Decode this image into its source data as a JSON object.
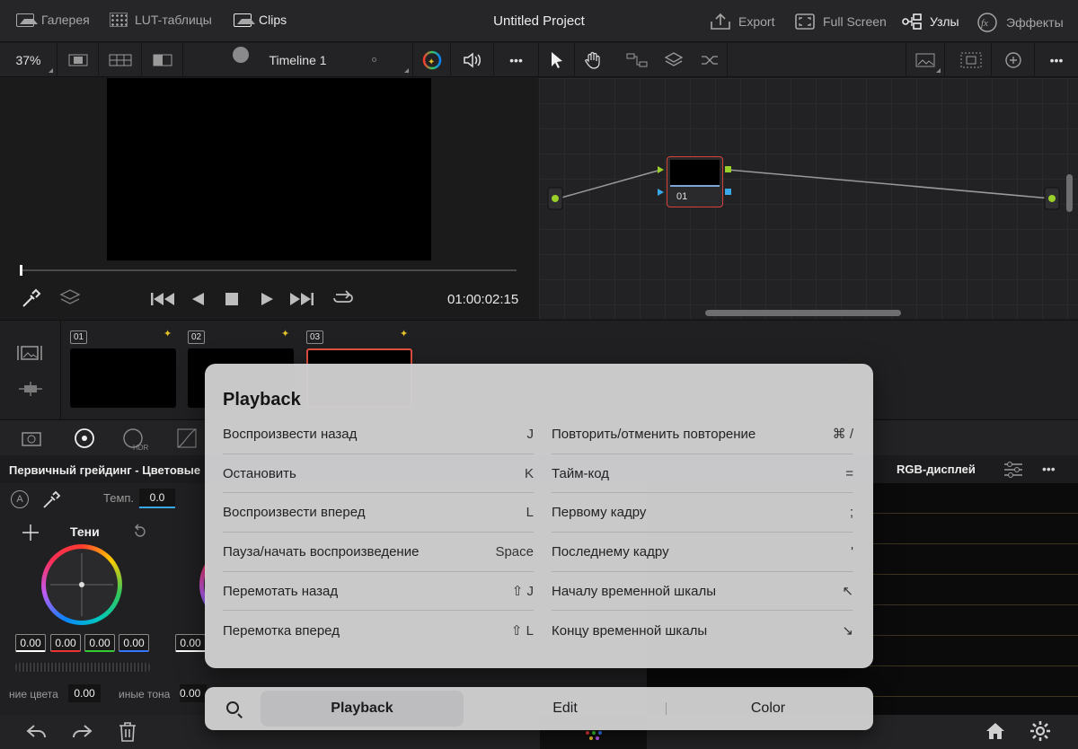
{
  "topbar": {
    "gallery": "Галерея",
    "luts": "LUT-таблицы",
    "clips": "Clips",
    "project_title": "Untitled Project",
    "export": "Export",
    "fullscreen": "Full Screen",
    "nodes": "Узлы",
    "effects": "Эффекты"
  },
  "toolbar2": {
    "zoom": "37%",
    "timeline": "Timeline 1",
    "more": "•••"
  },
  "viewer": {
    "timecode": "01:00:02:15"
  },
  "node_graph": {
    "node_label": "01"
  },
  "clips": [
    {
      "num": "01"
    },
    {
      "num": "02"
    },
    {
      "num": "03"
    }
  ],
  "panels": {
    "primary_title": "Первичный грейдинг - Цветовые",
    "temp_label": "Темп.",
    "temp_value": "0.0",
    "shadows_label": "Тени",
    "shadow_values": [
      "0.00",
      "0.00",
      "0.00",
      "0.00"
    ],
    "wheel2_value": "0.00",
    "rgb_title": "RGB-дисплей",
    "color_boost_label": "ние цвета",
    "color_boost_value": "0.00",
    "tone_label": "иные тона",
    "tone_value": "0.00"
  },
  "shortcuts": {
    "title": "Playback",
    "left": [
      {
        "label": "Воспроизвести назад",
        "key": "J"
      },
      {
        "label": "Остановить",
        "key": "K"
      },
      {
        "label": "Воспроизвести вперед",
        "key": "L"
      },
      {
        "label": "Пауза/начать воспроизведение",
        "key": "Space"
      },
      {
        "label": "Перемотать назад",
        "key": "⇧ J"
      },
      {
        "label": "Перемотка вперед",
        "key": "⇧ L"
      }
    ],
    "right": [
      {
        "label": "Повторить/отменить повторение",
        "key": "⌘ /"
      },
      {
        "label": "Тайм-код",
        "key": "="
      },
      {
        "label": "Первому кадру",
        "key": ";"
      },
      {
        "label": "Последнему кадру",
        "key": "'"
      },
      {
        "label": "Началу временной шкалы",
        "key": "↖"
      },
      {
        "label": "Концу временной шкалы",
        "key": "↘"
      }
    ]
  },
  "tabs": [
    {
      "label": "Playback",
      "active": true
    },
    {
      "label": "Edit",
      "active": false
    },
    {
      "label": "Color",
      "active": false
    }
  ]
}
